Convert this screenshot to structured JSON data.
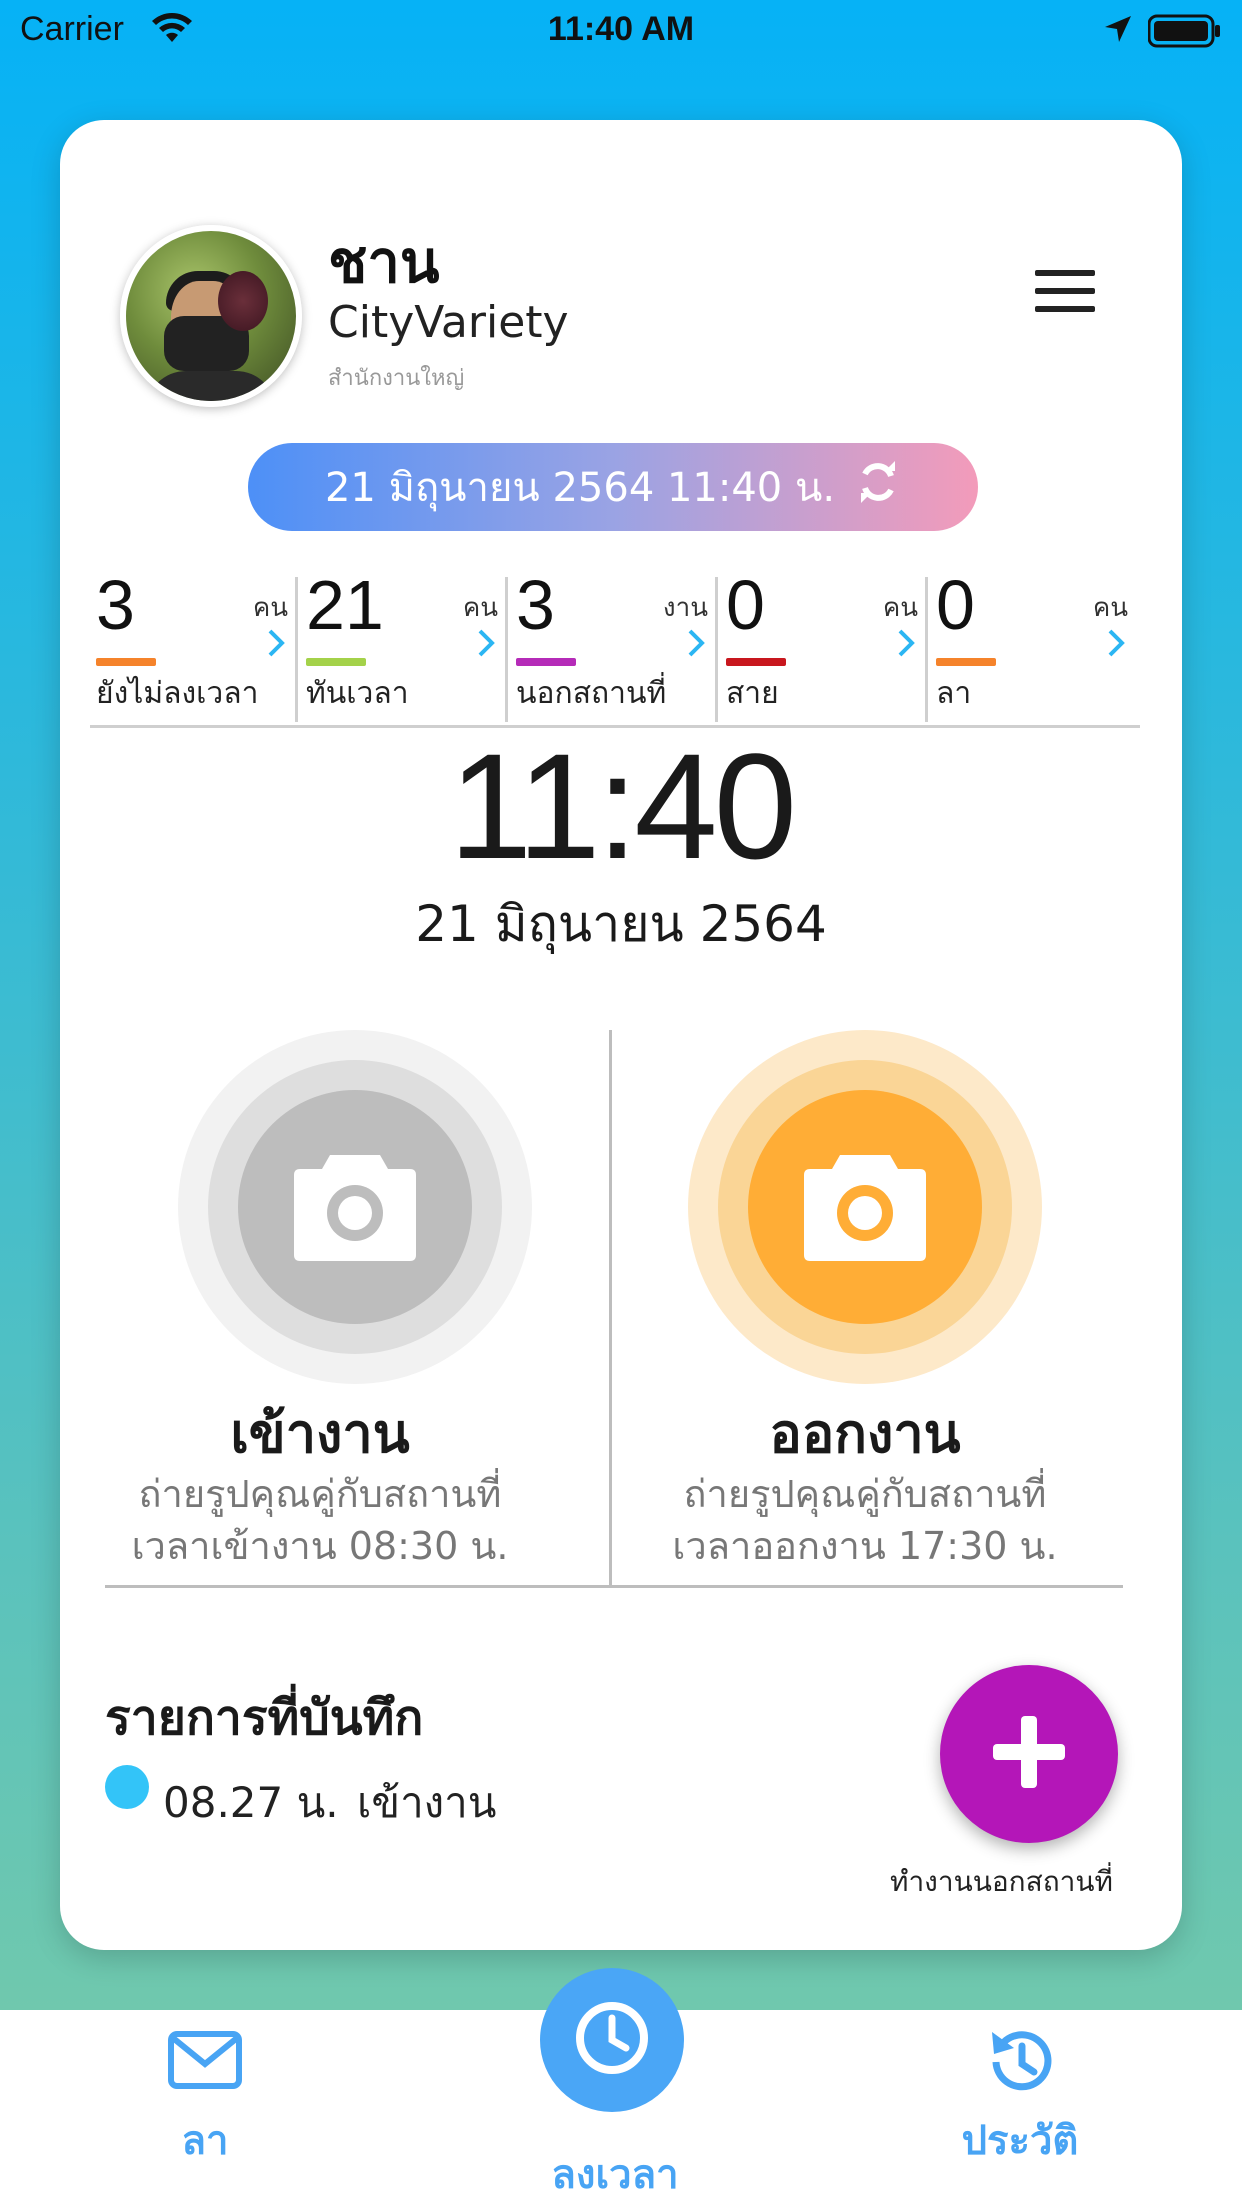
{
  "status_bar": {
    "carrier": "Carrier",
    "time": "11:40 AM"
  },
  "profile": {
    "name": "ชาน",
    "company": "CityVariety",
    "branch": "สำนักงานใหญ่"
  },
  "date_pill": {
    "text": "21 มิถุนายน 2564 11:40 น."
  },
  "stats": [
    {
      "value": "3",
      "unit": "คน",
      "label": "ยังไม่ลงเวลา",
      "color": "#f5832b"
    },
    {
      "value": "21",
      "unit": "คน",
      "label": "ทันเวลา",
      "color": "#a4d24a"
    },
    {
      "value": "3",
      "unit": "งาน",
      "label": "นอกสถานที่",
      "color": "#b52bb8"
    },
    {
      "value": "0",
      "unit": "คน",
      "label": "สาย",
      "color": "#c8171e"
    },
    {
      "value": "0",
      "unit": "คน",
      "label": "ลา",
      "color": "#f5832b"
    }
  ],
  "clock": {
    "time": "11:40",
    "date": "21 มิถุนายน 2564"
  },
  "check_in": {
    "title": "เข้างาน",
    "line1": "ถ่ายรูปคุณคู่กับสถานที่",
    "line2": "เวลาเข้างาน 08:30 น."
  },
  "check_out": {
    "title": "ออกงาน",
    "line1": "ถ่ายรูปคุณคู่กับสถานที่",
    "line2": "เวลาออกงาน 17:30 น."
  },
  "records": {
    "title": "รายการที่บันทึก",
    "items": [
      {
        "time": "08.27 น.",
        "type": "เข้างาน",
        "dot_color": "#33c4f8"
      }
    ]
  },
  "fab": {
    "label": "ทำงานนอกสถานที่"
  },
  "tabbar": {
    "leave": "ลา",
    "checkin": "ลงเวลา",
    "history": "ประวัติ"
  },
  "colors": {
    "accent": "#48a4f4",
    "check_out": "#ffad36",
    "fab": "#b416b8"
  }
}
